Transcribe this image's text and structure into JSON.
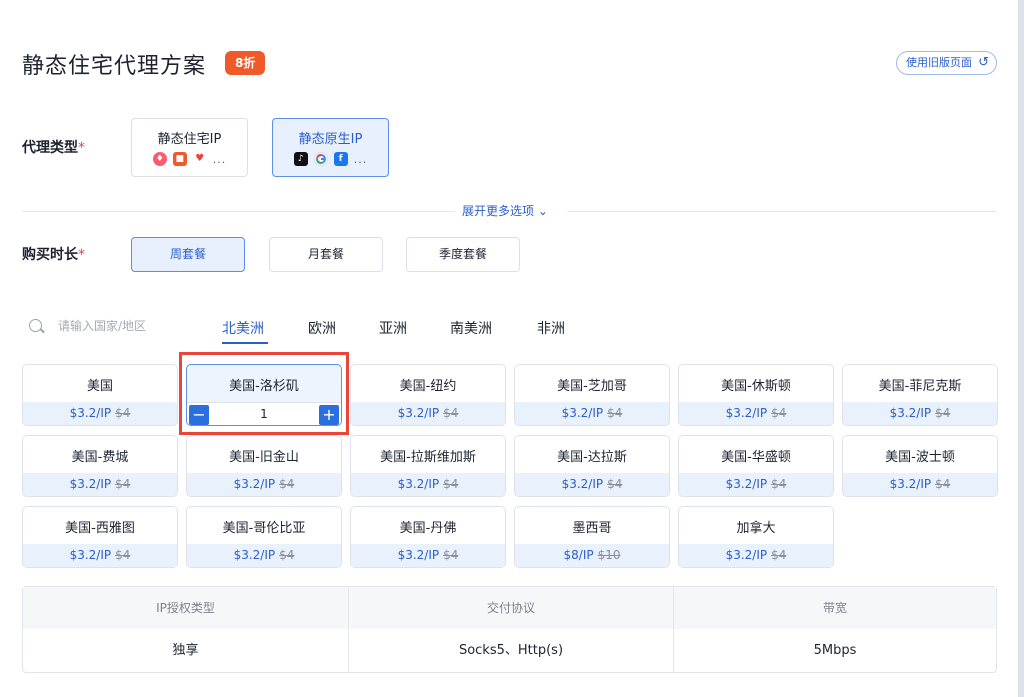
{
  "header": {
    "title": "静态住宅代理方案",
    "discount_badge": "8折",
    "legacy_button": "使用旧版页面"
  },
  "proxy_type": {
    "label": "代理类型",
    "required_mark": "*",
    "options": [
      {
        "label": "静态住宅IP",
        "icons": [
          "tinder-icon",
          "reddit-icon",
          "lazada-icon"
        ],
        "more": "...",
        "active": false
      },
      {
        "label": "静态原生IP",
        "icons": [
          "tiktok-icon",
          "google-icon",
          "facebook-icon"
        ],
        "more": "...",
        "active": true
      }
    ]
  },
  "expand_more": "展开更多选项",
  "duration": {
    "label": "购买时长",
    "required_mark": "*",
    "options": [
      {
        "label": "周套餐",
        "active": true
      },
      {
        "label": "月套餐",
        "active": false
      },
      {
        "label": "季度套餐",
        "active": false
      }
    ]
  },
  "search": {
    "placeholder": "请输入国家/地区",
    "value": ""
  },
  "regions": [
    {
      "label": "北美洲",
      "active": true
    },
    {
      "label": "欧洲",
      "active": false
    },
    {
      "label": "亚洲",
      "active": false
    },
    {
      "label": "南美洲",
      "active": false
    },
    {
      "label": "非洲",
      "active": false
    }
  ],
  "locations": [
    {
      "name": "美国",
      "price": "$3.2/IP",
      "old_price": "$4"
    },
    {
      "name": "美国-洛杉矶",
      "price": "$3.2/IP",
      "old_price": "$4",
      "selected": true,
      "quantity": "1"
    },
    {
      "name": "美国-纽约",
      "price": "$3.2/IP",
      "old_price": "$4"
    },
    {
      "name": "美国-芝加哥",
      "price": "$3.2/IP",
      "old_price": "$4"
    },
    {
      "name": "美国-休斯顿",
      "price": "$3.2/IP",
      "old_price": "$4"
    },
    {
      "name": "美国-菲尼克斯",
      "price": "$3.2/IP",
      "old_price": "$4"
    },
    {
      "name": "美国-费城",
      "price": "$3.2/IP",
      "old_price": "$4"
    },
    {
      "name": "美国-旧金山",
      "price": "$3.2/IP",
      "old_price": "$4"
    },
    {
      "name": "美国-拉斯维加斯",
      "price": "$3.2/IP",
      "old_price": "$4"
    },
    {
      "name": "美国-达拉斯",
      "price": "$3.2/IP",
      "old_price": "$4"
    },
    {
      "name": "美国-华盛顿",
      "price": "$3.2/IP",
      "old_price": "$4"
    },
    {
      "name": "美国-波士顿",
      "price": "$3.2/IP",
      "old_price": "$4"
    },
    {
      "name": "美国-西雅图",
      "price": "$3.2/IP",
      "old_price": "$4"
    },
    {
      "name": "美国-哥伦比亚",
      "price": "$3.2/IP",
      "old_price": "$4"
    },
    {
      "name": "美国-丹佛",
      "price": "$3.2/IP",
      "old_price": "$4"
    },
    {
      "name": "墨西哥",
      "price": "$8/IP",
      "old_price": "$10"
    },
    {
      "name": "加拿大",
      "price": "$3.2/IP",
      "old_price": "$4"
    }
  ],
  "info_table": {
    "headers": [
      "IP授权类型",
      "交付协议",
      "带宽"
    ],
    "values": [
      "独享",
      "Socks5、Http(s)",
      "5Mbps"
    ]
  },
  "colors": {
    "accent": "#2a5fc9",
    "discount": "#f05a2b",
    "highlight": "#e8463a"
  }
}
